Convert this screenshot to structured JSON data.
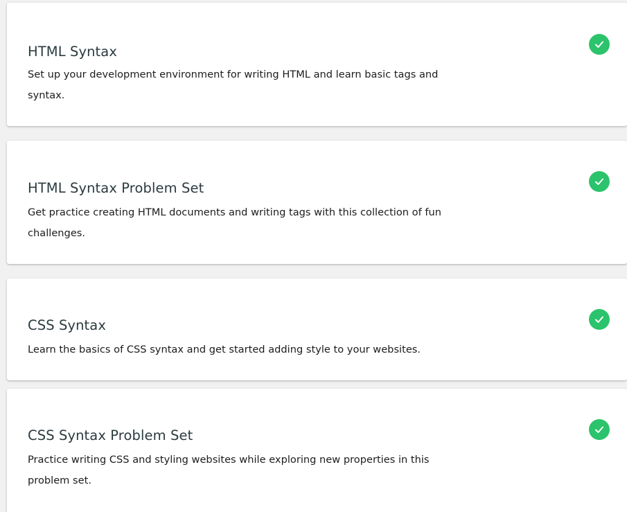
{
  "courses": [
    {
      "title": "HTML Syntax",
      "description": "Set up your development environment for writing HTML and learn basic tags and syntax.",
      "status_icon": "check-circle-icon"
    },
    {
      "title": "HTML Syntax Problem Set",
      "description": "Get practice creating HTML documents and writing tags with this collection of fun challenges.",
      "status_icon": "check-circle-icon"
    },
    {
      "title": "CSS Syntax",
      "description": "Learn the basics of CSS syntax and get started adding style to your websites.",
      "status_icon": "check-circle-icon"
    },
    {
      "title": "CSS Syntax Problem Set",
      "description": "Practice writing CSS and styling websites while exploring new properties in this problem set.",
      "status_icon": "check-circle-icon"
    }
  ],
  "colors": {
    "completed_check": "#2bc36b",
    "title_text": "#2b3a3e",
    "body_text": "#1c1c1c",
    "card_background": "#ffffff",
    "page_background": "#f1f1f1"
  }
}
